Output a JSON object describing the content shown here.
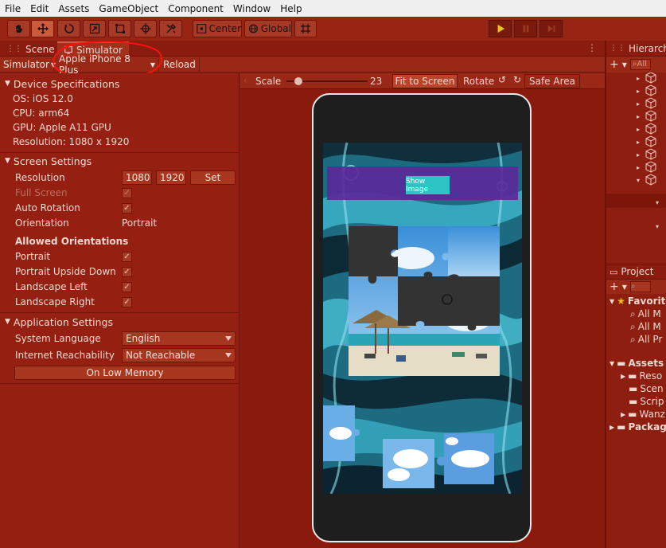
{
  "menu": [
    "File",
    "Edit",
    "Assets",
    "GameObject",
    "Component",
    "Window",
    "Help"
  ],
  "toolbar": {
    "pivot_label": "Center",
    "space_label": "Global"
  },
  "tabs": {
    "scene": "Scene",
    "simulator": "Simulator"
  },
  "subbar": {
    "mode": "Simulator",
    "device": "Apple iPhone 8 Plus",
    "reload": "Reload"
  },
  "device_specs": {
    "header": "Device Specifications",
    "os": "OS: iOS 12.0",
    "cpu": "CPU: arm64",
    "gpu": "GPU: Apple A11 GPU",
    "resolution": "Resolution: 1080 x 1920"
  },
  "screen_settings": {
    "header": "Screen Settings",
    "resolution_label": "Resolution",
    "res_w": "1080",
    "res_h": "1920",
    "set_label": "Set",
    "full_screen": "Full Screen",
    "auto_rotation": "Auto Rotation",
    "orientation_label": "Orientation",
    "orientation_value": "Portrait",
    "allowed_header": "Allowed Orientations",
    "portrait": "Portrait",
    "portrait_upside": "Portrait Upside Down",
    "landscape_left": "Landscape Left",
    "landscape_right": "Landscape Right"
  },
  "app_settings": {
    "header": "Application Settings",
    "system_language_label": "System Language",
    "system_language_value": "English",
    "reachability_label": "Internet Reachability",
    "reachability_value": "Not Reachable",
    "low_memory": "On Low Memory"
  },
  "view_controls": {
    "scale_label": "Scale",
    "scale_value": "23",
    "fit_to_screen": "Fit to Screen",
    "rotate": "Rotate",
    "safe_area": "Safe Area"
  },
  "game": {
    "show_image": "Show Image"
  },
  "hierarchy": {
    "title": "Hierarchy",
    "search_placeholder": "All"
  },
  "project": {
    "title": "Project",
    "favorites": "Favorit",
    "fav_items": [
      "All M",
      "All M",
      "All Pr"
    ],
    "assets": "Assets",
    "asset_items": [
      "Reso",
      "Scen",
      "Scrip",
      "Wanz"
    ],
    "packages": "Packag"
  }
}
